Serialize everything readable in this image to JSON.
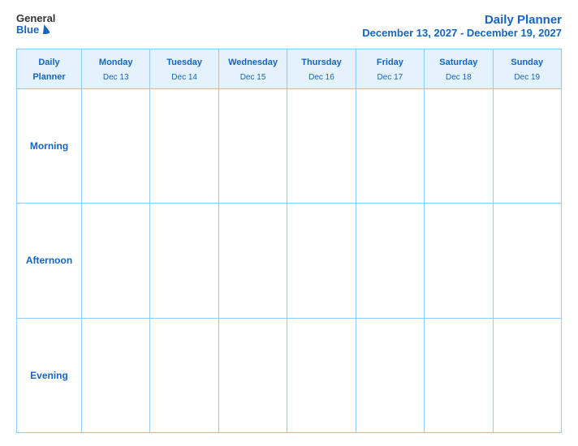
{
  "header": {
    "logo_general": "General",
    "logo_blue": "Blue",
    "title_line1": "Daily Planner",
    "title_line2": "December 13, 2027 - December 19, 2027"
  },
  "table": {
    "header_first_col_line1": "Daily",
    "header_first_col_line2": "Planner",
    "columns": [
      {
        "day": "Monday",
        "date": "Dec 13"
      },
      {
        "day": "Tuesday",
        "date": "Dec 14"
      },
      {
        "day": "Wednesday",
        "date": "Dec 15"
      },
      {
        "day": "Thursday",
        "date": "Dec 16"
      },
      {
        "day": "Friday",
        "date": "Dec 17"
      },
      {
        "day": "Saturday",
        "date": "Dec 18"
      },
      {
        "day": "Sunday",
        "date": "Dec 19"
      }
    ],
    "rows": [
      {
        "label": "Morning"
      },
      {
        "label": "Afternoon"
      },
      {
        "label": "Evening"
      }
    ]
  }
}
